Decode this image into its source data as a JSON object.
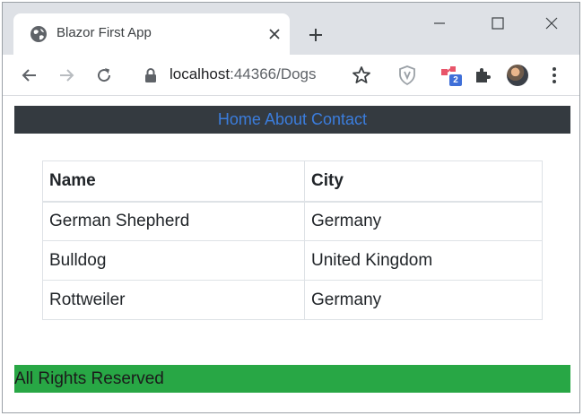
{
  "browser": {
    "tab": {
      "title": "Blazor First App",
      "favicon": "globe-icon"
    },
    "address_bar": {
      "host": "localhost",
      "rest": ":44366/Dogs"
    },
    "extension_badge": "2"
  },
  "nav": {
    "links": [
      {
        "label": "Home"
      },
      {
        "label": "About"
      },
      {
        "label": "Contact"
      }
    ]
  },
  "table": {
    "headers": [
      "Name",
      "City"
    ],
    "rows": [
      [
        "German Shepherd",
        "Germany"
      ],
      [
        "Bulldog",
        "United Kingdom"
      ],
      [
        "Rottweiler",
        "Germany"
      ]
    ]
  },
  "footer": {
    "text": "All Rights Reserved"
  },
  "colors": {
    "navbar_bg": "#343a40",
    "nav_link": "#3b7ddd",
    "footer_bg": "#28a745"
  }
}
